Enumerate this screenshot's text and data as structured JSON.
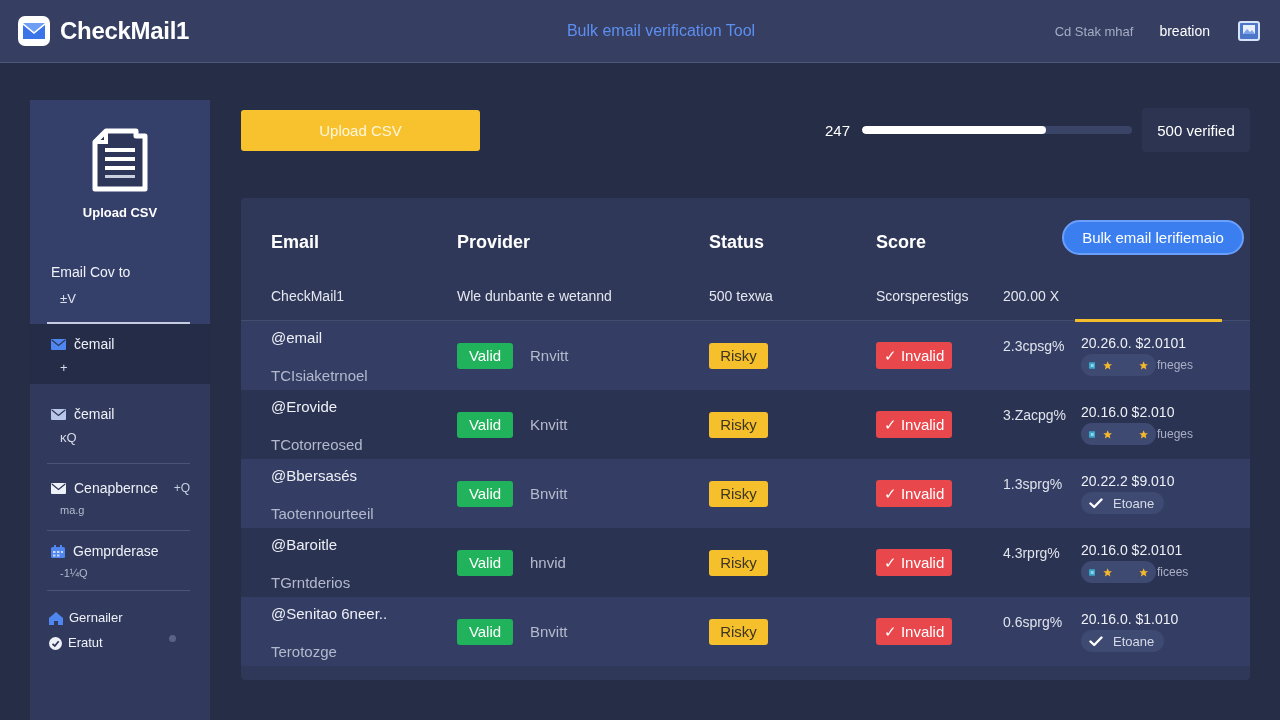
{
  "header": {
    "app_name": "CheckMail1",
    "title": "Bulk email verification Tool",
    "links": [
      "Cd Stak mhaf",
      "breation"
    ]
  },
  "sidebar": {
    "upload_label": "Upload CSV",
    "section": {
      "title": "Email Cov to",
      "subtitle": "±V"
    },
    "items": [
      {
        "label": "čemail",
        "detail": "+",
        "selected": true
      },
      {
        "label": "čemail",
        "detail": "ĸQ",
        "selected": false
      },
      {
        "label": "Cenapbernce",
        "badge": "+Q",
        "detail": "ma.g",
        "selected": false
      },
      {
        "label": "Gemprderase",
        "detail": "-1¼Q",
        "selected": false
      }
    ],
    "footer_items": [
      {
        "label": "Gernailer"
      },
      {
        "label": "Eratut"
      }
    ]
  },
  "toolbar": {
    "upload_button": "Upload CSV",
    "progress": {
      "count": "247",
      "level": 0.68,
      "total": "500 verified"
    }
  },
  "table": {
    "columns": [
      "Email",
      "Provider",
      "Status",
      "Score"
    ],
    "action_button": "Bulk email lerifiemaio",
    "summary": [
      "CheckMail1",
      "Wle dunbante e wetannd",
      "500 texwa",
      "Scorsperestigs",
      "200.00 X"
    ],
    "rows": [
      {
        "email": "@email",
        "note": "TCIsiaketrnoel",
        "validity": "Valid",
        "provider": "Rnvitt",
        "risk": "Risky",
        "result": "✓ Invalid",
        "score": "2.3cpsg%",
        "date": "20.26.0. $2.0101",
        "tag": {
          "kind": "starred",
          "label": "fneges"
        }
      },
      {
        "email": "@Erovide",
        "note": "TCotorreosed",
        "validity": "Valid",
        "provider": "Knvitt",
        "risk": "Risky",
        "result": "✓ Invalid",
        "score": "3.Zacpg%",
        "date": "20.16.0 $2.010",
        "tag": {
          "kind": "starred",
          "label": "fueges"
        }
      },
      {
        "email": "@Bbersasés",
        "note": "Taotennourteeil",
        "validity": "Valid",
        "provider": "Bnvitt",
        "risk": "Risky",
        "result": "✓ Invalid",
        "score": "1.3sprg%",
        "date": "20.22.2 $9.010",
        "tag": {
          "kind": "check",
          "label": "Etoane"
        }
      },
      {
        "email": "@Baroitle",
        "note": "TGrntderios",
        "validity": "Valid",
        "provider": "hnvid",
        "risk": "Risky",
        "result": "✓ Invalid",
        "score": "4.3rprg%",
        "date": "20.16.0 $2.0101",
        "tag": {
          "kind": "starred",
          "label": "ficees"
        }
      },
      {
        "email": "@Senitao 6neer..",
        "note": "Terotozge",
        "validity": "Valid",
        "provider": "Bnvitt",
        "risk": "Risky",
        "result": "✓ Invalid",
        "score": "0.6sprg%",
        "date": "20.16.0. $1.010",
        "tag": {
          "kind": "check",
          "label": "Etoane"
        }
      }
    ]
  }
}
